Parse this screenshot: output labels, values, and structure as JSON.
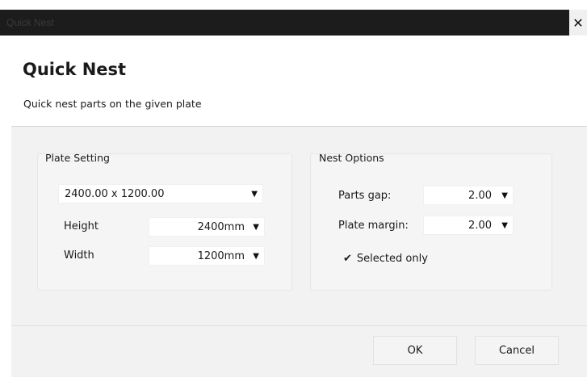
{
  "window": {
    "title": "Quick Nest",
    "close_glyph": "✕",
    "close_icon": "close-icon"
  },
  "header": {
    "title": "Quick Nest",
    "subtitle": "Quick nest parts on the given plate"
  },
  "plate_setting": {
    "label": "Plate Setting",
    "size_value": "2400.00 x 1200.00",
    "height_label": "Height",
    "height_value": "2400mm",
    "width_label": "Width",
    "width_value": "1200mm"
  },
  "nest_options": {
    "label": "Nest Options",
    "parts_gap_label": "Parts gap:",
    "parts_gap_value": "2.00",
    "plate_margin_label": "Plate margin:",
    "plate_margin_value": "2.00",
    "selected_only_label": "Selected only",
    "selected_only_checked": true
  },
  "icons": {
    "dropdown_arrow": "▼",
    "checkmark": "✔"
  },
  "buttons": {
    "ok": "OK",
    "cancel": "Cancel"
  }
}
